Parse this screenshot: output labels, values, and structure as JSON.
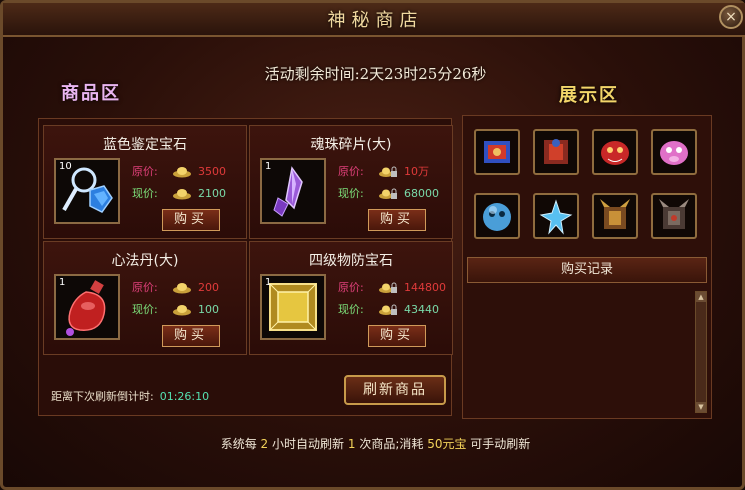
{
  "window": {
    "title": "神秘商店",
    "close_glyph": "×"
  },
  "timer": {
    "label": "活动剩余时间:",
    "value": "2天23时25分26秒"
  },
  "sections": {
    "shop": "商品区",
    "display": "展示区"
  },
  "goods": [
    {
      "name": "蓝色鉴定宝石",
      "qty": "10",
      "original_label": "原价:",
      "original_price": "3500",
      "current_label": "现价:",
      "current_price": "2100",
      "buy_label": "购买",
      "icon": "blue-gem-magnifier-icon",
      "currency_icon": "gold-ingot-icon"
    },
    {
      "name": "魂珠碎片(大)",
      "qty": "1",
      "original_label": "原价:",
      "original_price": "10万",
      "current_label": "现价:",
      "current_price": "68000",
      "buy_label": "购买",
      "icon": "purple-crystal-shard-icon",
      "currency_icon": "locked-gold-ingot-icon"
    },
    {
      "name": "心法丹(大)",
      "qty": "1",
      "original_label": "原价:",
      "original_price": "200",
      "current_label": "现价:",
      "current_price": "100",
      "buy_label": "购买",
      "icon": "red-potion-bottle-icon",
      "currency_icon": "gold-ingot-icon"
    },
    {
      "name": "四级物防宝石",
      "qty": "1",
      "original_label": "原价:",
      "original_price": "144800",
      "current_label": "现价:",
      "current_price": "43440",
      "buy_label": "购买",
      "icon": "golden-square-gem-icon",
      "currency_icon": "locked-gold-ingot-icon"
    }
  ],
  "refresh": {
    "countdown_label": "距离下次刷新倒计时:",
    "countdown_value": "01:26:10",
    "button_label": "刷新商品"
  },
  "showcase": [
    "blue-red-armor-icon",
    "red-armor-icon",
    "red-beast-icon",
    "pink-beast-icon",
    "blue-orb-creature-icon",
    "blue-crystal-burst-icon",
    "golden-spiked-armor-icon",
    "dark-spiked-armor-icon"
  ],
  "record": {
    "label": "购买记录"
  },
  "footer": {
    "part1": "系统每",
    "hours": "2",
    "part2": "小时自动刷新",
    "count": "1",
    "part3": "次商品;消耗",
    "cost": "50元宝",
    "part4": "可手动刷新"
  },
  "colors": {
    "original_price": "#e03a3a",
    "current_price": "#79d9a8",
    "highlight": "#f2d25a"
  }
}
